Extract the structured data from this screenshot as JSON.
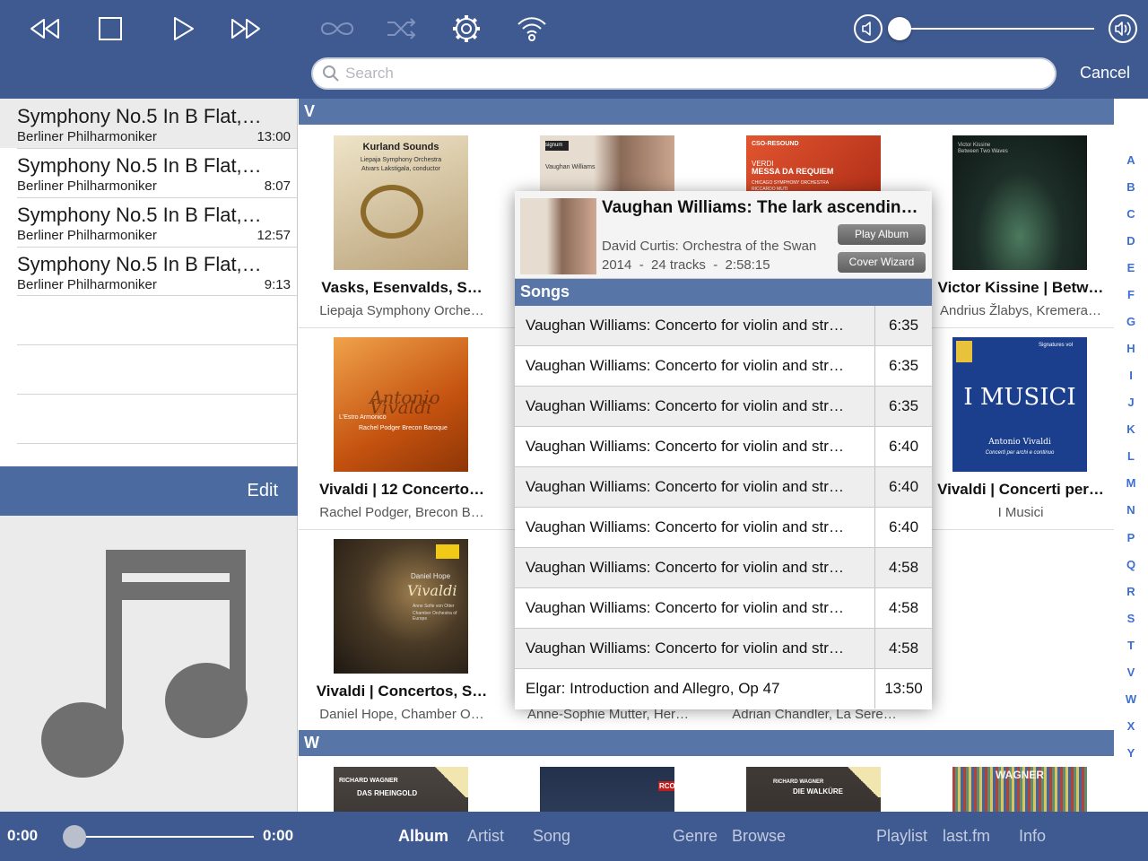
{
  "toolbar": {
    "icons": [
      "rewind-icon",
      "stop-icon",
      "play-icon",
      "fast-forward-icon",
      "repeat-icon",
      "shuffle-icon",
      "gear-icon",
      "wifi-icon",
      "volume-low-icon",
      "volume-high-icon"
    ],
    "volume_level": 0
  },
  "search": {
    "placeholder": "Search",
    "value": "",
    "cancel_label": "Cancel"
  },
  "queue": {
    "items": [
      {
        "title": "Symphony No.5 In B Flat,…",
        "artist": "Berliner Philharmoniker",
        "duration": "13:00"
      },
      {
        "title": "Symphony No.5 In B Flat,…",
        "artist": "Berliner Philharmoniker",
        "duration": "8:07"
      },
      {
        "title": "Symphony No.5 In B Flat,…",
        "artist": "Berliner Philharmoniker",
        "duration": "12:57"
      },
      {
        "title": "Symphony No.5 In B Flat,…",
        "artist": "Berliner Philharmoniker",
        "duration": "9:13"
      }
    ],
    "edit_label": "Edit"
  },
  "library": {
    "sections": [
      {
        "letter": "V",
        "albums": [
          {
            "title": "Vasks, Esenvalds, S…",
            "artist": "Liepaja Symphony Orche…",
            "cover_text": [
              "Kurland Sounds",
              "Liepaja Symphony Orchestra",
              "Atvars Lakstigala, conductor"
            ],
            "cover_color": "#d8c9a8"
          },
          {
            "title": "",
            "artist": "",
            "cover_text": [
              "signum",
              "Vaughan Williams"
            ],
            "cover_color": "#c9b9a8"
          },
          {
            "title": "",
            "artist": "",
            "cover_text": [
              "CSO-RESOUND",
              "VERDI",
              "MESSA DA REQUIEM",
              "CHICAGO SYMPHONY ORCHESTRA",
              "RICCARDO MUTI"
            ],
            "cover_color": "#c8341c"
          },
          {
            "title": "Victor Kissine | Betw…",
            "artist": "Andrius Žlabys, Kremera…",
            "cover_text": [
              "Victor Kissine",
              "Between Two Waves"
            ],
            "cover_color": "#1c2a24"
          },
          {
            "title": "Vivaldi | 12 Concerto…",
            "artist": "Rachel Podger, Brecon B…",
            "cover_text": [
              "Antonio Vivaldi",
              "L'Estro Armonico",
              "Rachel Podger Brecon Baroque"
            ],
            "cover_color": "#d9691c"
          },
          {
            "title": "",
            "artist": "",
            "cover_text": [],
            "cover_color": "#ffffff"
          },
          {
            "title": "",
            "artist": "",
            "cover_text": [],
            "cover_color": "#ffffff"
          },
          {
            "title": "Vivaldi | Concerti per…",
            "artist": "I Musici",
            "cover_text": [
              "Signatures vol",
              "I MUSICI",
              "Antonio Vivaldi",
              "Concerti per archi e continuo"
            ],
            "cover_color": "#1b3f8d"
          },
          {
            "title": "Vivaldi | Concertos, S…",
            "artist": "Daniel Hope, Chamber O…",
            "cover_text": [
              "Daniel Hope",
              "Vivaldi",
              "Anne Sofie von Otter",
              "Chamber Orchestra of Europe"
            ],
            "cover_color": "#3a3024"
          },
          {
            "title": "",
            "artist": "Anne-Sophie Mutter, Her…",
            "cover_text": [],
            "cover_color": "#ffffff"
          },
          {
            "title": "",
            "artist": "Adrian Chandler, La Sere…",
            "cover_text": [],
            "cover_color": "#ffffff"
          }
        ]
      },
      {
        "letter": "W",
        "albums": [
          {
            "title": "",
            "artist": "",
            "cover_text": [
              "RICHARD WAGNER",
              "DAS RHEINGOLD"
            ],
            "cover_color": "#3c3632"
          },
          {
            "title": "",
            "artist": "",
            "cover_text": [
              "RCO"
            ],
            "cover_color": "#2d3b56"
          },
          {
            "title": "",
            "artist": "",
            "cover_text": [
              "RICHARD WAGNER",
              "DIE WALKÜRE"
            ],
            "cover_color": "#393432"
          },
          {
            "title": "",
            "artist": "",
            "cover_text": [
              "WAGNER"
            ],
            "cover_color": "#8a7460"
          }
        ]
      }
    ]
  },
  "alpha_index": [
    "A",
    "B",
    "C",
    "D",
    "E",
    "F",
    "G",
    "H",
    "I",
    "J",
    "K",
    "L",
    "M",
    "N",
    "P",
    "Q",
    "R",
    "S",
    "T",
    "V",
    "W",
    "X",
    "Y"
  ],
  "popover": {
    "album_title": "Vaughan Williams: The lark ascendin…",
    "artist": "David Curtis: Orchestra of the Swan",
    "meta": "2014  -  24 tracks  -  2:58:15",
    "play_album_label": "Play Album",
    "cover_wizard_label": "Cover Wizard",
    "songs_header": "Songs",
    "songs": [
      {
        "title": "Vaughan Williams: Concerto for violin and str…",
        "duration": "6:35"
      },
      {
        "title": "Vaughan Williams: Concerto for violin and str…",
        "duration": "6:35"
      },
      {
        "title": "Vaughan Williams: Concerto for violin and str…",
        "duration": "6:35"
      },
      {
        "title": "Vaughan Williams: Concerto for violin and str…",
        "duration": "6:40"
      },
      {
        "title": "Vaughan Williams: Concerto for violin and str…",
        "duration": "6:40"
      },
      {
        "title": "Vaughan Williams: Concerto for violin and str…",
        "duration": "6:40"
      },
      {
        "title": "Vaughan Williams: Concerto for violin and str…",
        "duration": "4:58"
      },
      {
        "title": "Vaughan Williams: Concerto for violin and str…",
        "duration": "4:58"
      },
      {
        "title": "Vaughan Williams: Concerto for violin and str…",
        "duration": "4:58"
      },
      {
        "title": "Elgar: Introduction and Allegro, Op 47",
        "duration": "13:50"
      }
    ]
  },
  "player": {
    "elapsed": "0:00",
    "total": "0:00",
    "progress": 0
  },
  "tabs": [
    {
      "label": "Album",
      "active": true
    },
    {
      "label": "Artist",
      "active": false
    },
    {
      "label": "Song",
      "active": false
    },
    {
      "label": "Genre",
      "active": false
    },
    {
      "label": "Browse",
      "active": false
    },
    {
      "label": "Playlist",
      "active": false
    },
    {
      "label": "last.fm",
      "active": false
    },
    {
      "label": "Info",
      "active": false
    }
  ],
  "colors": {
    "toolbar": "#3f5a91",
    "section_header": "#5875a8",
    "index_letter": "#3d6fd1"
  }
}
